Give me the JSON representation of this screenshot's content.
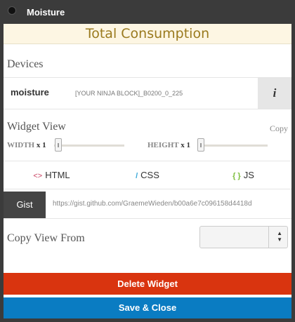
{
  "window": {
    "title": "Moisture"
  },
  "header": {
    "title": "Total Consumption"
  },
  "devices": {
    "label": "Devices",
    "name": "moisture",
    "guid": "[YOUR NINJA BLOCK]_B0200_0_225",
    "info_label": "i"
  },
  "widget_view": {
    "label": "Widget View",
    "copy_label": "Copy",
    "width_label": "WIDTH",
    "width_value": "x 1",
    "height_label": "HEIGHT",
    "height_value": "x 1"
  },
  "tabs": {
    "html_icon": "<>",
    "html": "HTML",
    "css_icon": "/",
    "css": "CSS",
    "js_icon": "{ }",
    "js": "JS"
  },
  "gist": {
    "button": "Gist",
    "url": "https://gist.github.com/GraemeWieden/b00a6e7c096158d4418d"
  },
  "copy_view": {
    "label": "Copy View From",
    "selected": ""
  },
  "buttons": {
    "delete": "Delete Widget",
    "save": "Save & Close"
  },
  "colors": {
    "delete": "#d9340f",
    "save": "#0a7cc2",
    "header_text": "#9a7a1e"
  }
}
